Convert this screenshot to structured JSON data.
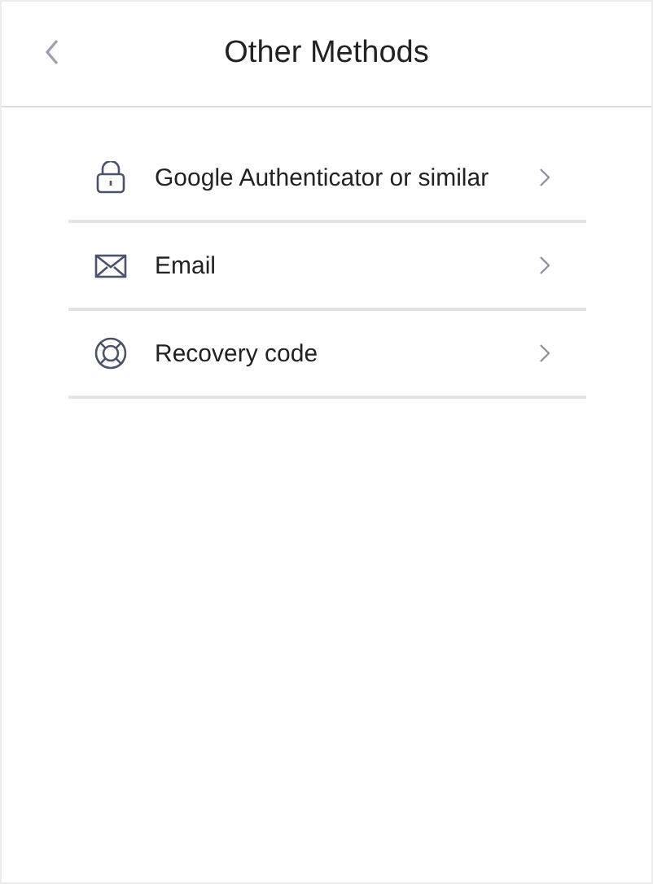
{
  "header": {
    "title": "Other Methods"
  },
  "methods": [
    {
      "kind": "lock",
      "label": "Google Authenticator or similar"
    },
    {
      "kind": "email",
      "label": "Email"
    },
    {
      "kind": "lifebuoy",
      "label": "Recovery code"
    }
  ]
}
